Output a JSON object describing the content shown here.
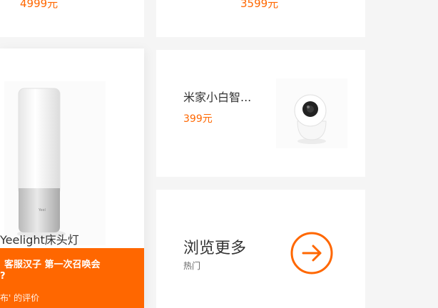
{
  "top_row": {
    "left_price": "4999元",
    "right_price": "3599元"
  },
  "lamp_card": {
    "name": "Yeelight床头灯",
    "review": {
      "text": "客服汉子 第一次召唤会",
      "text_cont": "?",
      "author": "布' 的评价"
    }
  },
  "camera_card": {
    "name": "米家小白智...",
    "price": "399元"
  },
  "browse_more": {
    "title": "浏览更多",
    "subtitle": "热门"
  },
  "colors": {
    "accent": "#ff6700",
    "bg": "#f5f5f5"
  }
}
